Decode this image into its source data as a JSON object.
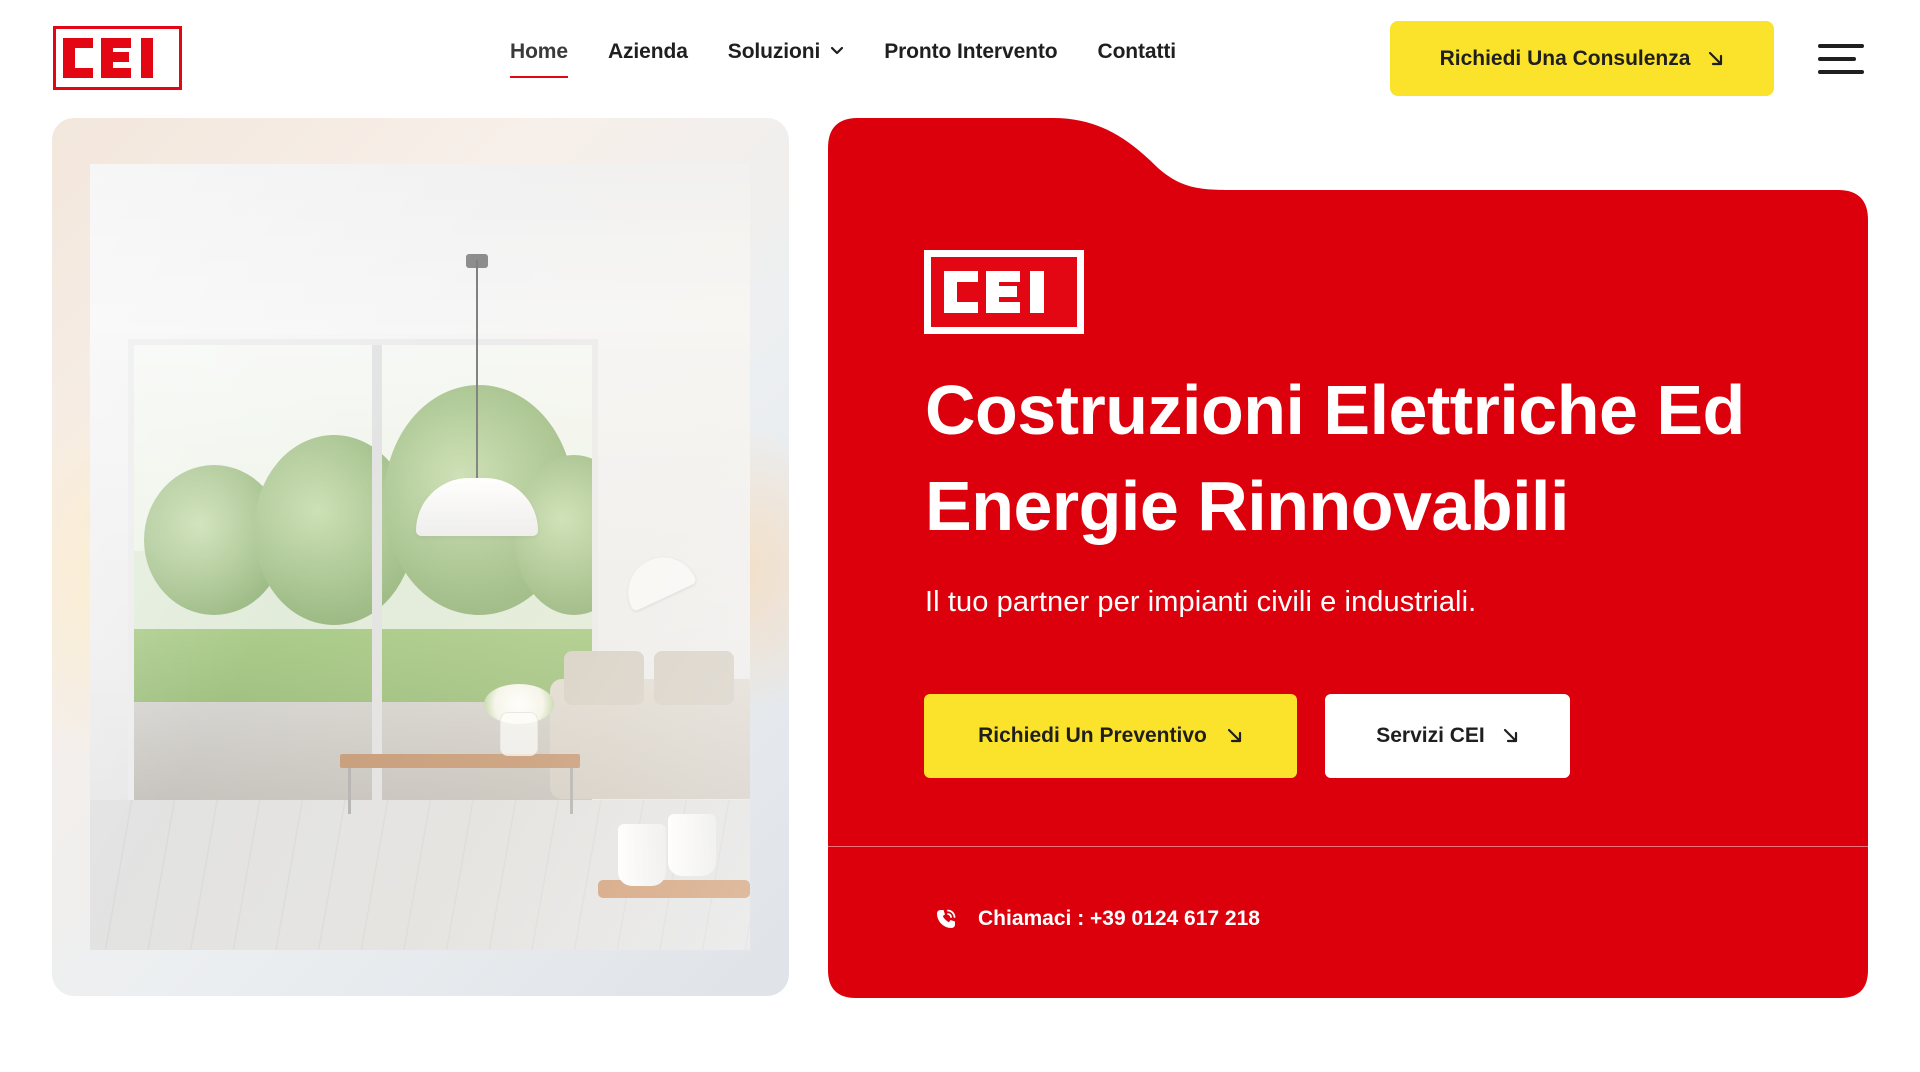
{
  "brand": {
    "logo_text": "CEI",
    "red": "#e30613",
    "yellow": "#fbe22b"
  },
  "nav": {
    "items": [
      {
        "label": "Home",
        "active": true
      },
      {
        "label": "Azienda"
      },
      {
        "label": "Soluzioni",
        "has_dropdown": true
      },
      {
        "label": "Pronto Intervento"
      },
      {
        "label": "Contatti"
      }
    ],
    "cta_label": "Richiedi Una Consulenza",
    "menu_icon": "hamburger-menu-icon"
  },
  "hero": {
    "title_line1": "Costruzioni Elettriche Ed",
    "title_line2": "Energie Rinnovabili",
    "subtitle": "Il tuo partner per impianti civili e industriali.",
    "primary_button": "Richiedi Un Preventivo",
    "secondary_button": "Servizi CEI",
    "phone_label": "Chiamaci : +39 0124 617 218",
    "phone_icon": "phone-icon",
    "arrow_icon": "arrow-down-right-icon"
  }
}
